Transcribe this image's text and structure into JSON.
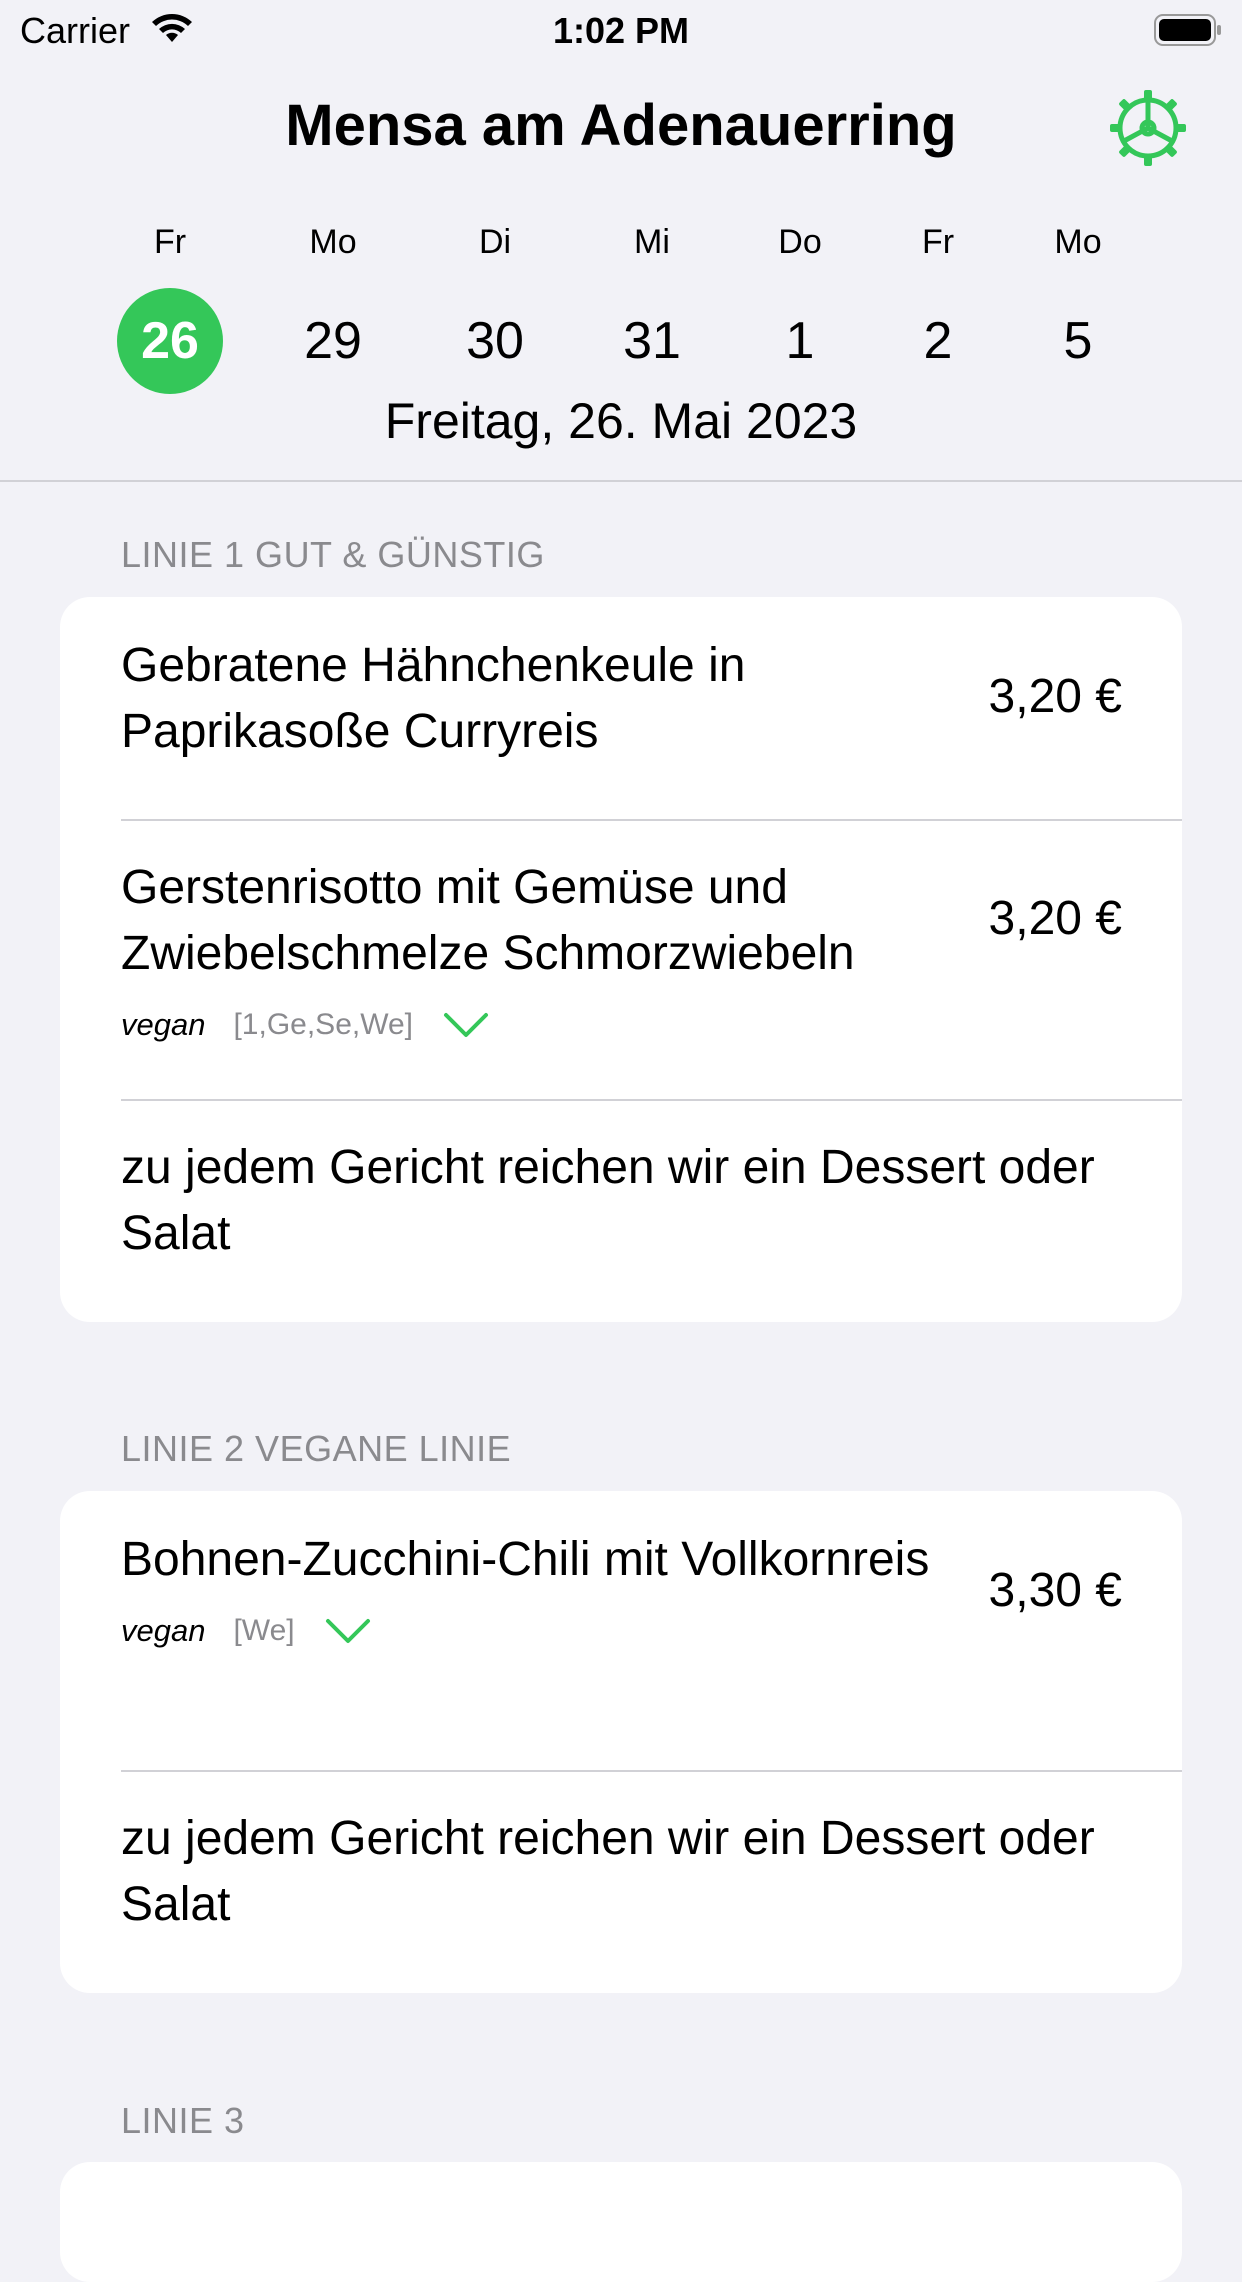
{
  "status_bar": {
    "carrier": "Carrier",
    "time": "1:02 PM"
  },
  "header": {
    "title": "Mensa am Adenauerring",
    "settings_icon": "gear-icon",
    "days": [
      {
        "abbr": "Fr",
        "num": "26",
        "selected": true
      },
      {
        "abbr": "Mo",
        "num": "29",
        "selected": false
      },
      {
        "abbr": "Di",
        "num": "30",
        "selected": false
      },
      {
        "abbr": "Mi",
        "num": "31",
        "selected": false
      },
      {
        "abbr": "Do",
        "num": "1",
        "selected": false
      },
      {
        "abbr": "Fr",
        "num": "2",
        "selected": false
      },
      {
        "abbr": "Mo",
        "num": "5",
        "selected": false
      }
    ],
    "full_date": "Freitag, 26. Mai 2023"
  },
  "sections": [
    {
      "title": "LINIE 1 GUT & GÜNSTIG",
      "items": [
        {
          "name": "Gebratene Hähnchenkeule in Paprikasoße Curryreis",
          "price": "3,20 €"
        },
        {
          "name": "Gerstenrisotto mit Gemüse und Zwiebelschmelze Schmorzwiebeln",
          "price": "3,20 €",
          "tag": "vegan",
          "allergens": "[1,Ge,Se,We]"
        },
        {
          "name": "zu jedem Gericht reichen wir ein Dessert oder Salat"
        }
      ]
    },
    {
      "title": "LINIE 2 VEGANE LINIE",
      "items": [
        {
          "name": "Bohnen-Zucchini-Chili mit Vollkornreis",
          "price": "3,30 €",
          "tag": "vegan",
          "allergens": "[We]"
        },
        {
          "name": "zu jedem Gericht reichen wir ein Dessert oder Salat"
        }
      ]
    },
    {
      "title": "LINIE 3",
      "items": []
    }
  ],
  "colors": {
    "accent": "#34c759",
    "background": "#f2f2f7",
    "secondary_text": "#8a8a8e",
    "separator": "#d1d1d6"
  }
}
